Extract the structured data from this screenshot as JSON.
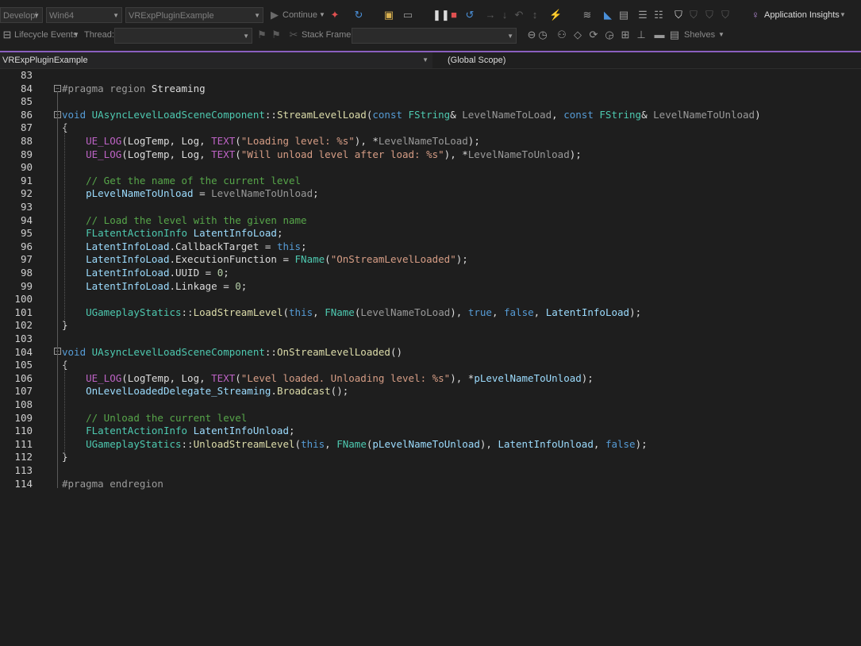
{
  "toolbar": {
    "config": "Developi",
    "platform": "Win64",
    "project": "VRExpPluginExample",
    "continue": "Continue",
    "app_insights": "Application Insights",
    "lifecycle": "Lifecycle Events",
    "thread": "Thread:",
    "stack_frame": "Stack Frame:",
    "shelves": "Shelves"
  },
  "navbar": {
    "project": "VRExpPluginExample",
    "scope": "(Global Scope)"
  },
  "editor": {
    "line_numbers": [
      "83",
      "84",
      "85",
      "86",
      "87",
      "88",
      "89",
      "90",
      "91",
      "92",
      "93",
      "94",
      "95",
      "96",
      "97",
      "98",
      "99",
      "100",
      "101",
      "102",
      "103",
      "104",
      "105",
      "106",
      "107",
      "108",
      "109",
      "110",
      "111",
      "112",
      "113",
      "114"
    ],
    "lines": [
      [],
      [
        {
          "t": "#pragma region ",
          "c": "pp"
        },
        {
          "t": "Streaming",
          "c": "plain"
        }
      ],
      [],
      [
        {
          "t": "void ",
          "c": "kw"
        },
        {
          "t": "UAsyncLevelLoadSceneComponent",
          "c": "ty"
        },
        {
          "t": "::",
          "c": "plain"
        },
        {
          "t": "StreamLevelLoad",
          "c": "fn"
        },
        {
          "t": "(",
          "c": "plain"
        },
        {
          "t": "const ",
          "c": "kw"
        },
        {
          "t": "FString",
          "c": "ty"
        },
        {
          "t": "& ",
          "c": "plain"
        },
        {
          "t": "LevelNameToLoad",
          "c": "par"
        },
        {
          "t": ", ",
          "c": "plain"
        },
        {
          "t": "const ",
          "c": "kw"
        },
        {
          "t": "FString",
          "c": "ty"
        },
        {
          "t": "& ",
          "c": "plain"
        },
        {
          "t": "LevelNameToUnload",
          "c": "par"
        },
        {
          "t": ")",
          "c": "plain"
        }
      ],
      [
        {
          "t": "{",
          "c": "plain"
        }
      ],
      [
        {
          "t": "    ",
          "c": "plain"
        },
        {
          "t": "UE_LOG",
          "c": "mac"
        },
        {
          "t": "(LogTemp, Log, ",
          "c": "plain"
        },
        {
          "t": "TEXT",
          "c": "mac"
        },
        {
          "t": "(",
          "c": "plain"
        },
        {
          "t": "\"Loading level: %s\"",
          "c": "st"
        },
        {
          "t": "), *",
          "c": "plain"
        },
        {
          "t": "LevelNameToLoad",
          "c": "par"
        },
        {
          "t": ");",
          "c": "plain"
        }
      ],
      [
        {
          "t": "    ",
          "c": "plain"
        },
        {
          "t": "UE_LOG",
          "c": "mac"
        },
        {
          "t": "(LogTemp, Log, ",
          "c": "plain"
        },
        {
          "t": "TEXT",
          "c": "mac"
        },
        {
          "t": "(",
          "c": "plain"
        },
        {
          "t": "\"Will unload level after load: %s\"",
          "c": "st"
        },
        {
          "t": "), *",
          "c": "plain"
        },
        {
          "t": "LevelNameToUnload",
          "c": "par"
        },
        {
          "t": ");",
          "c": "plain"
        }
      ],
      [],
      [
        {
          "t": "    ",
          "c": "plain"
        },
        {
          "t": "// Get the name of the current level",
          "c": "cm"
        }
      ],
      [
        {
          "t": "    ",
          "c": "plain"
        },
        {
          "t": "pLevelNameToUnload",
          "c": "vr"
        },
        {
          "t": " = ",
          "c": "plain"
        },
        {
          "t": "LevelNameToUnload",
          "c": "par"
        },
        {
          "t": ";",
          "c": "plain"
        }
      ],
      [],
      [
        {
          "t": "    ",
          "c": "plain"
        },
        {
          "t": "// Load the level with the given name",
          "c": "cm"
        }
      ],
      [
        {
          "t": "    ",
          "c": "plain"
        },
        {
          "t": "FLatentActionInfo",
          "c": "ty"
        },
        {
          "t": " ",
          "c": "plain"
        },
        {
          "t": "LatentInfoLoad",
          "c": "vr"
        },
        {
          "t": ";",
          "c": "plain"
        }
      ],
      [
        {
          "t": "    ",
          "c": "plain"
        },
        {
          "t": "LatentInfoLoad",
          "c": "vr"
        },
        {
          "t": ".CallbackTarget = ",
          "c": "plain"
        },
        {
          "t": "this",
          "c": "kw"
        },
        {
          "t": ";",
          "c": "plain"
        }
      ],
      [
        {
          "t": "    ",
          "c": "plain"
        },
        {
          "t": "LatentInfoLoad",
          "c": "vr"
        },
        {
          "t": ".ExecutionFunction = ",
          "c": "plain"
        },
        {
          "t": "FName",
          "c": "ty"
        },
        {
          "t": "(",
          "c": "plain"
        },
        {
          "t": "\"OnStreamLevelLoaded\"",
          "c": "st"
        },
        {
          "t": ");",
          "c": "plain"
        }
      ],
      [
        {
          "t": "    ",
          "c": "plain"
        },
        {
          "t": "LatentInfoLoad",
          "c": "vr"
        },
        {
          "t": ".UUID = ",
          "c": "plain"
        },
        {
          "t": "0",
          "c": "nm"
        },
        {
          "t": ";",
          "c": "plain"
        }
      ],
      [
        {
          "t": "    ",
          "c": "plain"
        },
        {
          "t": "LatentInfoLoad",
          "c": "vr"
        },
        {
          "t": ".Linkage = ",
          "c": "plain"
        },
        {
          "t": "0",
          "c": "nm"
        },
        {
          "t": ";",
          "c": "plain"
        }
      ],
      [],
      [
        {
          "t": "    ",
          "c": "plain"
        },
        {
          "t": "UGameplayStatics",
          "c": "ty"
        },
        {
          "t": "::",
          "c": "plain"
        },
        {
          "t": "LoadStreamLevel",
          "c": "fn"
        },
        {
          "t": "(",
          "c": "plain"
        },
        {
          "t": "this",
          "c": "kw"
        },
        {
          "t": ", ",
          "c": "plain"
        },
        {
          "t": "FName",
          "c": "ty"
        },
        {
          "t": "(",
          "c": "plain"
        },
        {
          "t": "LevelNameToLoad",
          "c": "par"
        },
        {
          "t": "), ",
          "c": "plain"
        },
        {
          "t": "true",
          "c": "kw"
        },
        {
          "t": ", ",
          "c": "plain"
        },
        {
          "t": "false",
          "c": "kw"
        },
        {
          "t": ", ",
          "c": "plain"
        },
        {
          "t": "LatentInfoLoad",
          "c": "vr"
        },
        {
          "t": ");",
          "c": "plain"
        }
      ],
      [
        {
          "t": "}",
          "c": "plain"
        }
      ],
      [],
      [
        {
          "t": "void ",
          "c": "kw"
        },
        {
          "t": "UAsyncLevelLoadSceneComponent",
          "c": "ty"
        },
        {
          "t": "::",
          "c": "plain"
        },
        {
          "t": "OnStreamLevelLoaded",
          "c": "fn"
        },
        {
          "t": "()",
          "c": "plain"
        }
      ],
      [
        {
          "t": "{",
          "c": "plain"
        }
      ],
      [
        {
          "t": "    ",
          "c": "plain"
        },
        {
          "t": "UE_LOG",
          "c": "mac"
        },
        {
          "t": "(LogTemp, Log, ",
          "c": "plain"
        },
        {
          "t": "TEXT",
          "c": "mac"
        },
        {
          "t": "(",
          "c": "plain"
        },
        {
          "t": "\"Level loaded. Unloading level: %s\"",
          "c": "st"
        },
        {
          "t": "), *",
          "c": "plain"
        },
        {
          "t": "pLevelNameToUnload",
          "c": "vr"
        },
        {
          "t": ");",
          "c": "plain"
        }
      ],
      [
        {
          "t": "    ",
          "c": "plain"
        },
        {
          "t": "OnLevelLoadedDelegate_Streaming",
          "c": "vr"
        },
        {
          "t": ".",
          "c": "plain"
        },
        {
          "t": "Broadcast",
          "c": "fn"
        },
        {
          "t": "();",
          "c": "plain"
        }
      ],
      [],
      [
        {
          "t": "    ",
          "c": "plain"
        },
        {
          "t": "// Unload the current level",
          "c": "cm"
        }
      ],
      [
        {
          "t": "    ",
          "c": "plain"
        },
        {
          "t": "FLatentActionInfo",
          "c": "ty"
        },
        {
          "t": " ",
          "c": "plain"
        },
        {
          "t": "LatentInfoUnload",
          "c": "vr"
        },
        {
          "t": ";",
          "c": "plain"
        }
      ],
      [
        {
          "t": "    ",
          "c": "plain"
        },
        {
          "t": "UGameplayStatics",
          "c": "ty"
        },
        {
          "t": "::",
          "c": "plain"
        },
        {
          "t": "UnloadStreamLevel",
          "c": "fn"
        },
        {
          "t": "(",
          "c": "plain"
        },
        {
          "t": "this",
          "c": "kw"
        },
        {
          "t": ", ",
          "c": "plain"
        },
        {
          "t": "FName",
          "c": "ty"
        },
        {
          "t": "(",
          "c": "plain"
        },
        {
          "t": "pLevelNameToUnload",
          "c": "vr"
        },
        {
          "t": "), ",
          "c": "plain"
        },
        {
          "t": "LatentInfoUnload",
          "c": "vr"
        },
        {
          "t": ", ",
          "c": "plain"
        },
        {
          "t": "false",
          "c": "kw"
        },
        {
          "t": ");",
          "c": "plain"
        }
      ],
      [
        {
          "t": "}",
          "c": "plain"
        }
      ],
      [],
      [
        {
          "t": "#pragma endregion",
          "c": "pp"
        }
      ]
    ]
  }
}
